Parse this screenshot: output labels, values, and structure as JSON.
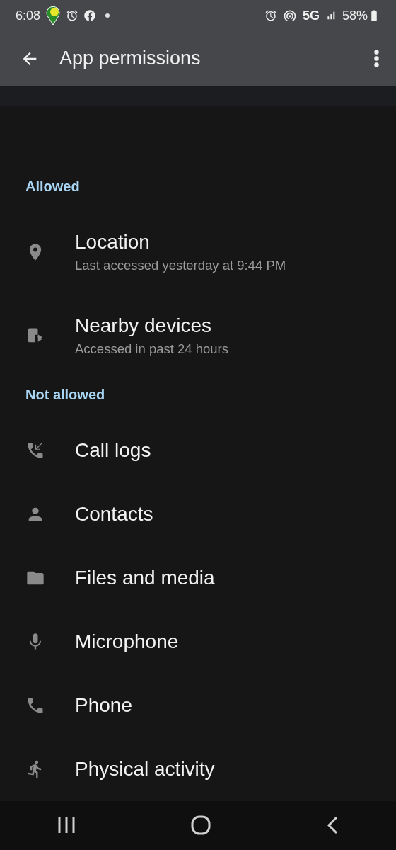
{
  "status_bar": {
    "time": "6:08",
    "network": "5G",
    "battery": "58%"
  },
  "app_bar": {
    "title": "App permissions"
  },
  "sections": [
    {
      "header": "Allowed",
      "items": [
        {
          "title": "Location",
          "subtitle": "Last accessed yesterday at 9:44 PM"
        },
        {
          "title": "Nearby devices",
          "subtitle": "Accessed in past 24 hours"
        }
      ]
    },
    {
      "header": "Not allowed",
      "items": [
        {
          "title": "Call logs"
        },
        {
          "title": "Contacts"
        },
        {
          "title": "Files and media"
        },
        {
          "title": "Microphone"
        },
        {
          "title": "Phone"
        },
        {
          "title": "Physical activity"
        }
      ]
    }
  ]
}
